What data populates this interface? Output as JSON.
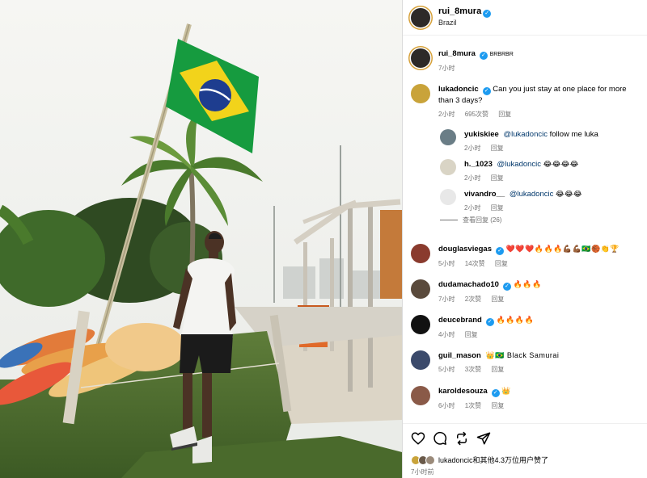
{
  "post": {
    "author": "rui_8mura",
    "location": "Brazil",
    "verified_mark": "✓"
  },
  "caption": {
    "user": "rui_8mura",
    "text": "BRBRBR",
    "time": "7小时"
  },
  "comments": [
    {
      "user": "lukadoncic",
      "verified": true,
      "text": "Can you just stay at one place for more than 3 days?",
      "time": "2小时",
      "likes": "695次赞",
      "reply": "回复",
      "avatar_color": "#c9a33a"
    },
    {
      "user": "yukiskiee",
      "mention": "@lukadoncic",
      "text": "follow me luka",
      "time": "2小时",
      "reply": "回复",
      "avatar_color": "#6a7d86",
      "is_reply": true
    },
    {
      "user": "h._1023",
      "mention": "@lukadoncic",
      "text": "😂😂😂😂",
      "time": "2小时",
      "reply": "回复",
      "avatar_color": "#d9d4c5",
      "is_reply": true
    },
    {
      "user": "vivandro__",
      "mention": "@lukadoncic",
      "text": "😂😂😂",
      "time": "2小时",
      "reply": "回复",
      "avatar_color": "#e8e8e8",
      "is_reply": true
    },
    {
      "user": "douglasviegas",
      "verified": true,
      "text": "❤️❤️❤️🔥🔥🔥💪🏾💪🏾🇧🇷🏀👏🏆",
      "time": "5小时",
      "likes": "14次赞",
      "reply": "回复",
      "avatar_color": "#8a3b2e"
    },
    {
      "user": "dudamachado10",
      "verified": true,
      "text": "🔥🔥🔥",
      "time": "7小时",
      "likes": "2次赞",
      "reply": "回复",
      "avatar_color": "#5a4a3c"
    },
    {
      "user": "deucebrand",
      "verified": true,
      "text": "🔥🔥🔥🔥",
      "time": "4小时",
      "reply": "回复",
      "avatar_color": "#111111"
    },
    {
      "user": "guil_mason",
      "text": "👑🇧🇷 Black Samurai",
      "time": "5小时",
      "likes": "3次赞",
      "reply": "回复",
      "avatar_color": "#3b4a6b"
    },
    {
      "user": "karoldesouza",
      "verified": true,
      "text": "👑",
      "time": "6小时",
      "likes": "1次赞",
      "reply": "回复",
      "avatar_color": "#8a5a48"
    }
  ],
  "view_replies": "查看回复 (26)",
  "actions": {
    "like_icon": "heart-icon",
    "comment_icon": "comment-icon",
    "share_icon": "repost-icon",
    "send_icon": "send-icon"
  },
  "liked_by": "lukadoncic和其他4.3万位用户赞了",
  "posted_ago": "7小时前",
  "colors": {
    "verified_blue": "#1d9bf0",
    "mention_blue": "#00376b",
    "muted": "#737373"
  }
}
